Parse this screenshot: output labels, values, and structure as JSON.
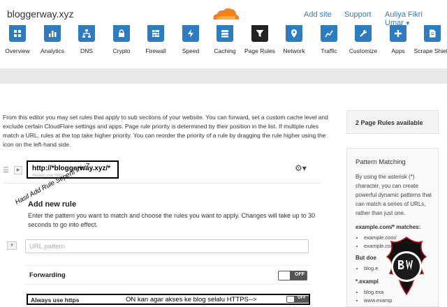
{
  "header": {
    "site_name": "bloggerway.xyz",
    "add_site": "Add site",
    "support": "Support",
    "user": "Auliya Fikri Umar",
    "brand_color": "#f38020"
  },
  "tabs": [
    {
      "label": "Overview",
      "icon": "overview-icon"
    },
    {
      "label": "Analytics",
      "icon": "analytics-icon"
    },
    {
      "label": "DNS",
      "icon": "dns-icon"
    },
    {
      "label": "Crypto",
      "icon": "lock-icon"
    },
    {
      "label": "Firewall",
      "icon": "firewall-icon"
    },
    {
      "label": "Speed",
      "icon": "lightning-icon"
    },
    {
      "label": "Caching",
      "icon": "caching-icon"
    },
    {
      "label": "Page Rules",
      "icon": "filter-icon",
      "active": true
    },
    {
      "label": "Network",
      "icon": "location-pin-icon"
    },
    {
      "label": "Traffic",
      "icon": "traffic-icon"
    },
    {
      "label": "Customize",
      "icon": "wrench-icon"
    },
    {
      "label": "Apps",
      "icon": "plus-icon"
    },
    {
      "label": "Scrape Shield",
      "icon": "document-icon"
    }
  ],
  "main": {
    "intro": "From this editor you may set rules that apply to sub sections of your website. You can forward, set a custom cache level and exclude certain CloudFlare settings and apps. Page rule priority is determined by their position in the list. If multiple rules match a URL, rules at the top take higher priority. You can reorder the priority of a rule by dragging the rule higher using the icon on the left-hand side.",
    "rule_url": "http://*bloggerway.xyz/*",
    "rule_sub": "Always use https",
    "add_new": "Add new rule",
    "help": "Enter the pattern you want to match and choose the rules you want to apply. Changes will take up to 30 seconds to go into effect.",
    "annotation": "Hasil Add Rule Seperti Ini-->",
    "url_placeholder": "URL pattern",
    "forwarding_label": "Forwarding",
    "forwarding_state": "OFF",
    "https_label": "Always use https",
    "https_note": "ON kan agar akses ke blog selalu HTTPS-->",
    "https_state": "OFF"
  },
  "side": {
    "rules_available": "2 Page Rules available",
    "pm_title": "Pattern Matching",
    "pm_desc": "By using the asterisk (*) character, you can create powerful dynamic patterns that can match a series of URLs, rather than just one.",
    "ex1_title": "example.com/* matches:",
    "ex1_items": [
      "example.com/",
      "example.com/"
    ],
    "but_title": "But doe",
    "but_items": [
      "blog.e"
    ],
    "ex2_title": "*.exampl",
    "ex2_items": [
      "blog.exa",
      "www.examp"
    ]
  }
}
